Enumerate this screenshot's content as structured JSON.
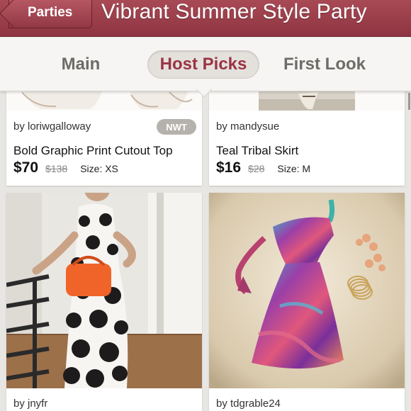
{
  "header": {
    "back_label": "Parties",
    "title": "Vibrant Summer Style Party"
  },
  "tabs": [
    {
      "label": "Main"
    },
    {
      "label": "Host Picks"
    },
    {
      "label": "First Look"
    }
  ],
  "listings": [
    {
      "seller": "by loriwgalloway",
      "badge": "NWT",
      "title": "Bold Graphic Print Cutout Top",
      "price": "$70",
      "original_price": "$138",
      "size": "Size: XS"
    },
    {
      "seller": "by mandysue",
      "title": "Teal Tribal Skirt",
      "price": "$16",
      "original_price": "$28",
      "size": "Size: M"
    },
    {
      "seller": "by jnyfr"
    },
    {
      "seller": "by tdgrable24"
    }
  ],
  "colors": {
    "header": "#8e3441",
    "active_tab_text": "#9a3444",
    "background": "#e8e6e3"
  }
}
